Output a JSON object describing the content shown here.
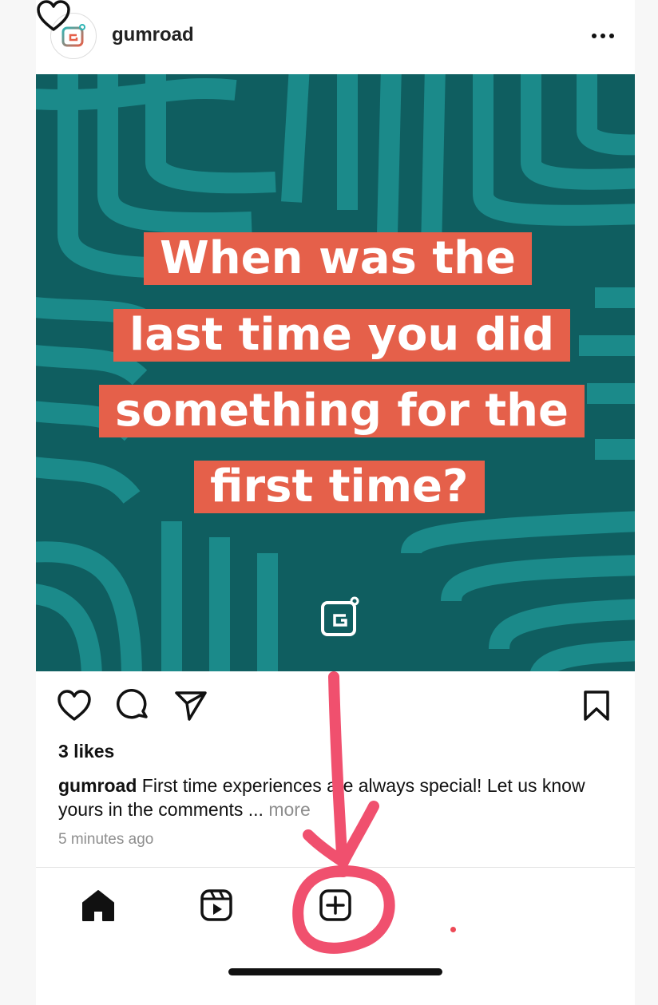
{
  "post": {
    "username": "gumroad",
    "image_text_lines": [
      "When was the",
      "last time you did",
      "something for the",
      "first time?"
    ],
    "likes": "3 likes",
    "caption_user": "gumroad",
    "caption_text": " First time experiences are always special! Let us know yours in the comments ... ",
    "caption_more": "more",
    "timestamp": "5 minutes ago"
  },
  "icons": {
    "avatar": "gumroad-logo-icon",
    "options": "more-horizontal-icon",
    "like": "heart-icon",
    "comment": "comment-icon",
    "share": "paper-plane-icon",
    "save": "bookmark-icon"
  },
  "bottom_nav": {
    "items": [
      "home-icon",
      "reels-icon",
      "create-post-icon",
      "activity-heart-icon"
    ]
  },
  "colors": {
    "image_bg": "#0f5e60",
    "image_stripes": "#1b8a8a",
    "text_highlight": "#e5604a",
    "annotation": "#f0506e",
    "notification_dot": "#ed4956"
  }
}
